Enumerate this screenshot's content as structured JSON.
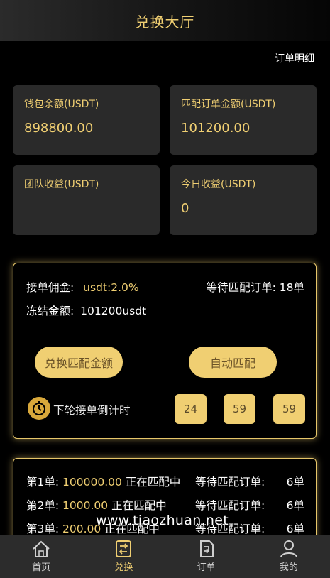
{
  "header": {
    "title": "兑换大厅"
  },
  "order_detail_link": "订单明细",
  "stats": [
    {
      "label": "钱包余额(USDT)",
      "value": "898800.00"
    },
    {
      "label": "匹配订单金额(USDT)",
      "value": "101200.00"
    },
    {
      "label": "团队收益(USDT)",
      "value": ""
    },
    {
      "label": "今日收益(USDT)",
      "value": "0"
    }
  ],
  "panel": {
    "commission_label": "接单佣金:",
    "commission_value": "usdt:2.0%",
    "waiting_label": "等待匹配订单:",
    "waiting_value": "18单",
    "frozen_label": "冻结金额:",
    "frozen_value": "101200usdt",
    "exchange_button": "兑换匹配金额",
    "auto_button": "自动匹配",
    "countdown_label": "下轮接单倒计时",
    "countdown": [
      "24",
      "59",
      "59"
    ]
  },
  "match_rows": [
    {
      "prefix": "第1单:",
      "amount": "100000.00",
      "status": "正在匹配中",
      "waiting_label": "等待匹配订单:",
      "waiting_value": "6单"
    },
    {
      "prefix": "第2单:",
      "amount": "1000.00",
      "status": "正在匹配中",
      "waiting_label": "等待匹配订单:",
      "waiting_value": "6单"
    },
    {
      "prefix": "第3单:",
      "amount": "200.00",
      "status": "正在匹配中",
      "waiting_label": "等待匹配订单:",
      "waiting_value": "6单"
    }
  ],
  "watermark": "www.tiaozhuan.net",
  "nav": [
    {
      "label": "首页",
      "icon": "home-icon",
      "active": false
    },
    {
      "label": "兑换",
      "icon": "exchange-icon",
      "active": true
    },
    {
      "label": "订单",
      "icon": "order-icon",
      "active": false
    },
    {
      "label": "我的",
      "icon": "user-icon",
      "active": false
    }
  ],
  "colors": {
    "accent": "#f0cf72",
    "background": "#000000",
    "card": "#2a2a2a",
    "nav": "#2c2c2c"
  }
}
